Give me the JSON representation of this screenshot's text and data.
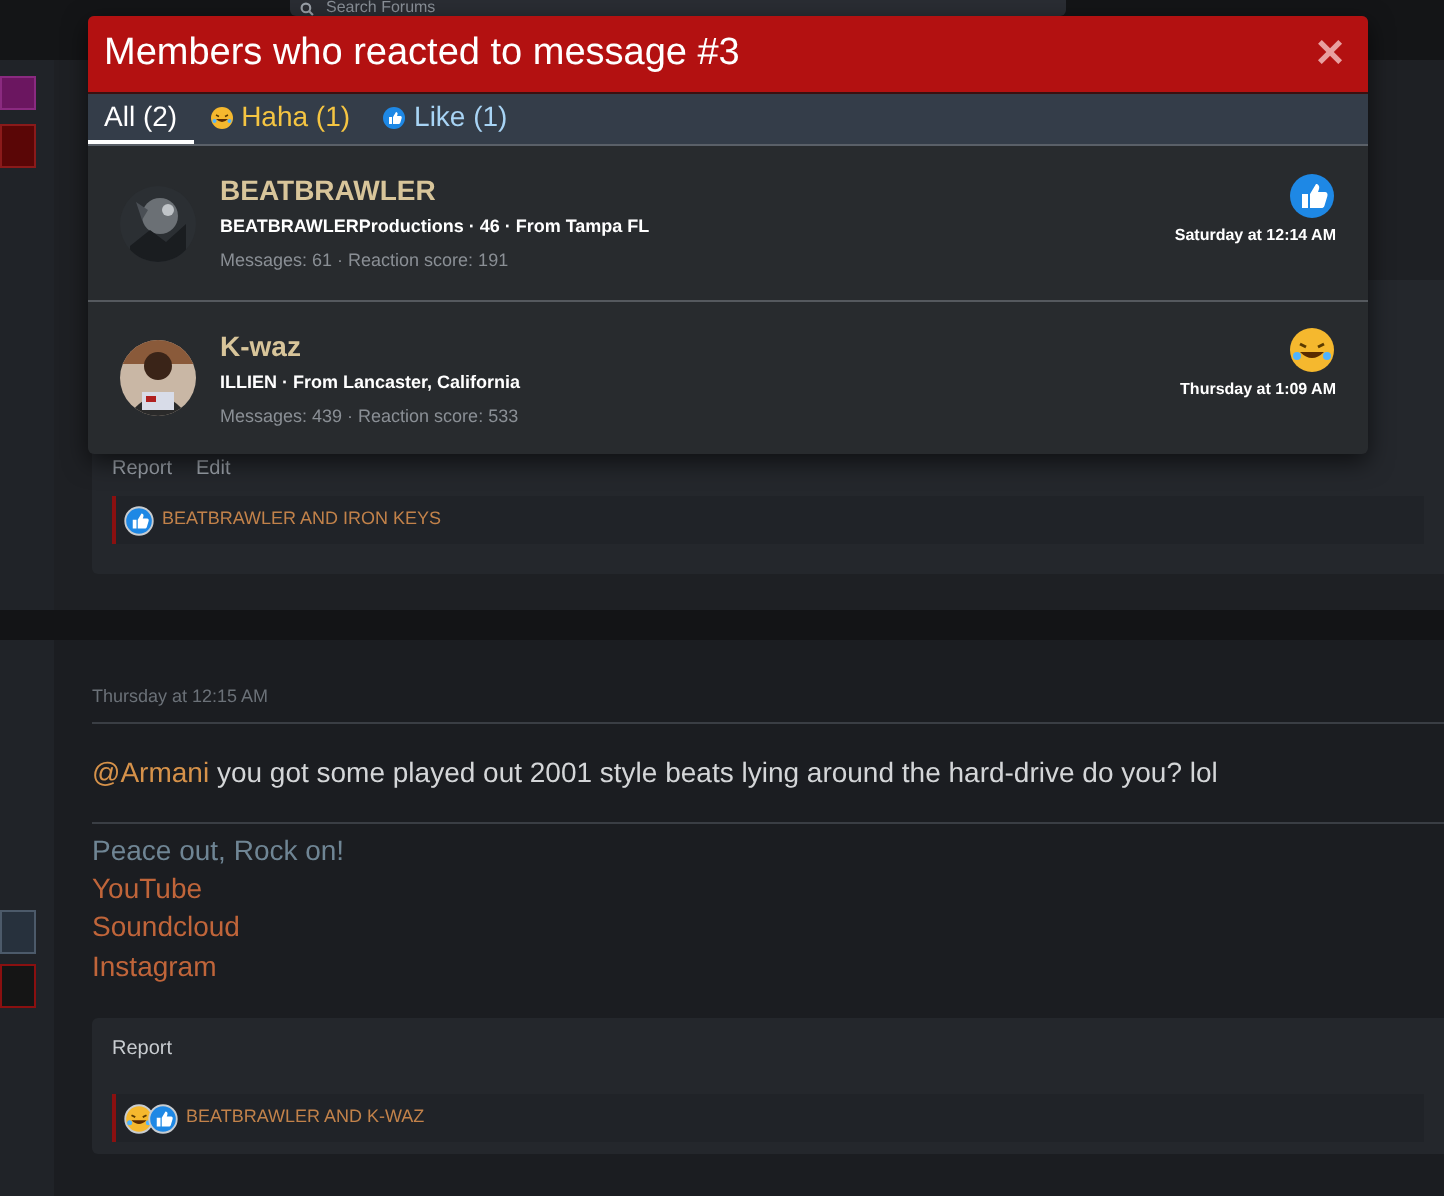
{
  "search": {
    "placeholder": "Search Forums"
  },
  "dialog": {
    "title": "Members who reacted to message #3",
    "close": "×"
  },
  "tabs": [
    {
      "label": "All (2)",
      "selected": true,
      "kind": "all"
    },
    {
      "label": "Haha (1)",
      "selected": false,
      "kind": "haha"
    },
    {
      "label": "Like (1)",
      "selected": false,
      "kind": "like"
    }
  ],
  "members": [
    {
      "name": "BEATBRAWLER",
      "details": "BEATBRAWLERProductions · 46 · From Tampa FL",
      "stats": "Messages: 61 · Reaction score: 191",
      "reaction": {
        "kind": "like"
      },
      "time": "Saturday at 12:14 AM"
    },
    {
      "name": "K-waz",
      "details": "ILLIEN · From Lancaster, California",
      "stats": "Messages: 439 · Reaction score: 533",
      "reaction": {
        "kind": "haha"
      },
      "time": "Thursday at 1:09 AM"
    }
  ],
  "posts": [
    {
      "actions": [
        "Report",
        "Edit"
      ],
      "reactions": [
        {
          "kind": "like"
        }
      ],
      "reacted_by": "BEATBRAWLER AND IRON KEYS"
    },
    {
      "date": "Thursday at 12:15 AM",
      "mention": "@Armani",
      "body": " you got some played out 2001 style beats lying around the hard-drive do you? lol",
      "signature": "Peace out, Rock on!",
      "links": [
        "YouTube",
        "Soundcloud",
        "Instagram"
      ],
      "actions": [
        "Report"
      ],
      "reactions": [
        {
          "kind": "haha"
        },
        {
          "kind": "like"
        }
      ],
      "reacted_by": "BEATBRAWLER AND K-WAZ"
    }
  ]
}
